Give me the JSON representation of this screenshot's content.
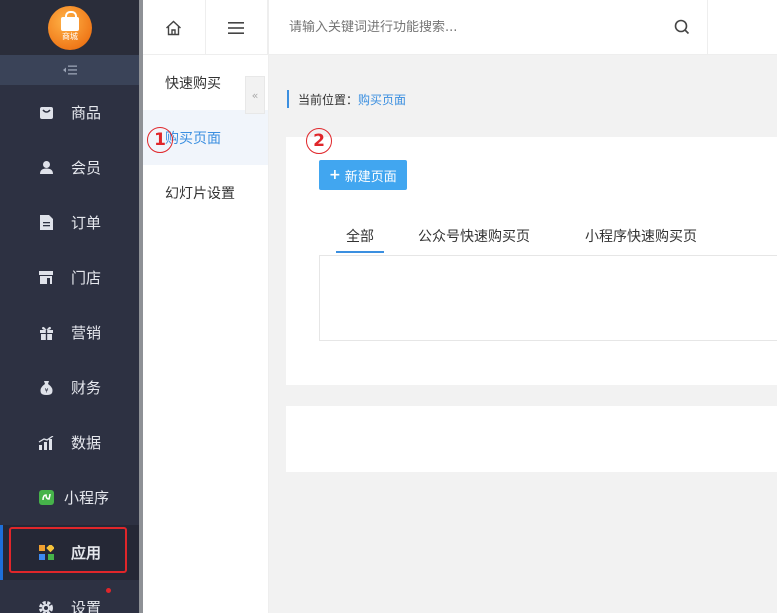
{
  "logo": {
    "text": "商城"
  },
  "sidebar": {
    "items": [
      {
        "label": "商品",
        "icon": "bag-icon"
      },
      {
        "label": "会员",
        "icon": "user-icon"
      },
      {
        "label": "订单",
        "icon": "document-icon"
      },
      {
        "label": "门店",
        "icon": "store-icon"
      },
      {
        "label": "营销",
        "icon": "gift-icon"
      },
      {
        "label": "财务",
        "icon": "money-bag-icon"
      },
      {
        "label": "数据",
        "icon": "chart-icon"
      },
      {
        "label": "小程序",
        "icon": "mini-program-icon"
      },
      {
        "label": "应用",
        "icon": "apps-icon"
      },
      {
        "label": "设置",
        "icon": "gear-icon"
      }
    ]
  },
  "subnav": {
    "items": [
      {
        "label": "快速购买"
      },
      {
        "label": "购买页面"
      },
      {
        "label": "幻灯片设置"
      }
    ]
  },
  "topbar": {
    "search_placeholder": "请输入关键词进行功能搜索..."
  },
  "breadcrumb": {
    "label": "当前位置：",
    "current": "购买页面"
  },
  "main": {
    "new_button": "新建页面",
    "tabs": [
      {
        "label": "全部"
      },
      {
        "label": "公众号快速购买页"
      },
      {
        "label": "小程序快速购买页"
      }
    ]
  },
  "annotations": {
    "step1": "1",
    "step2": "2"
  },
  "colors": {
    "sidebar_bg": "#2d3142",
    "accent": "#3b8fe0",
    "button": "#41a6f0",
    "annotation_red": "#e0262a"
  }
}
